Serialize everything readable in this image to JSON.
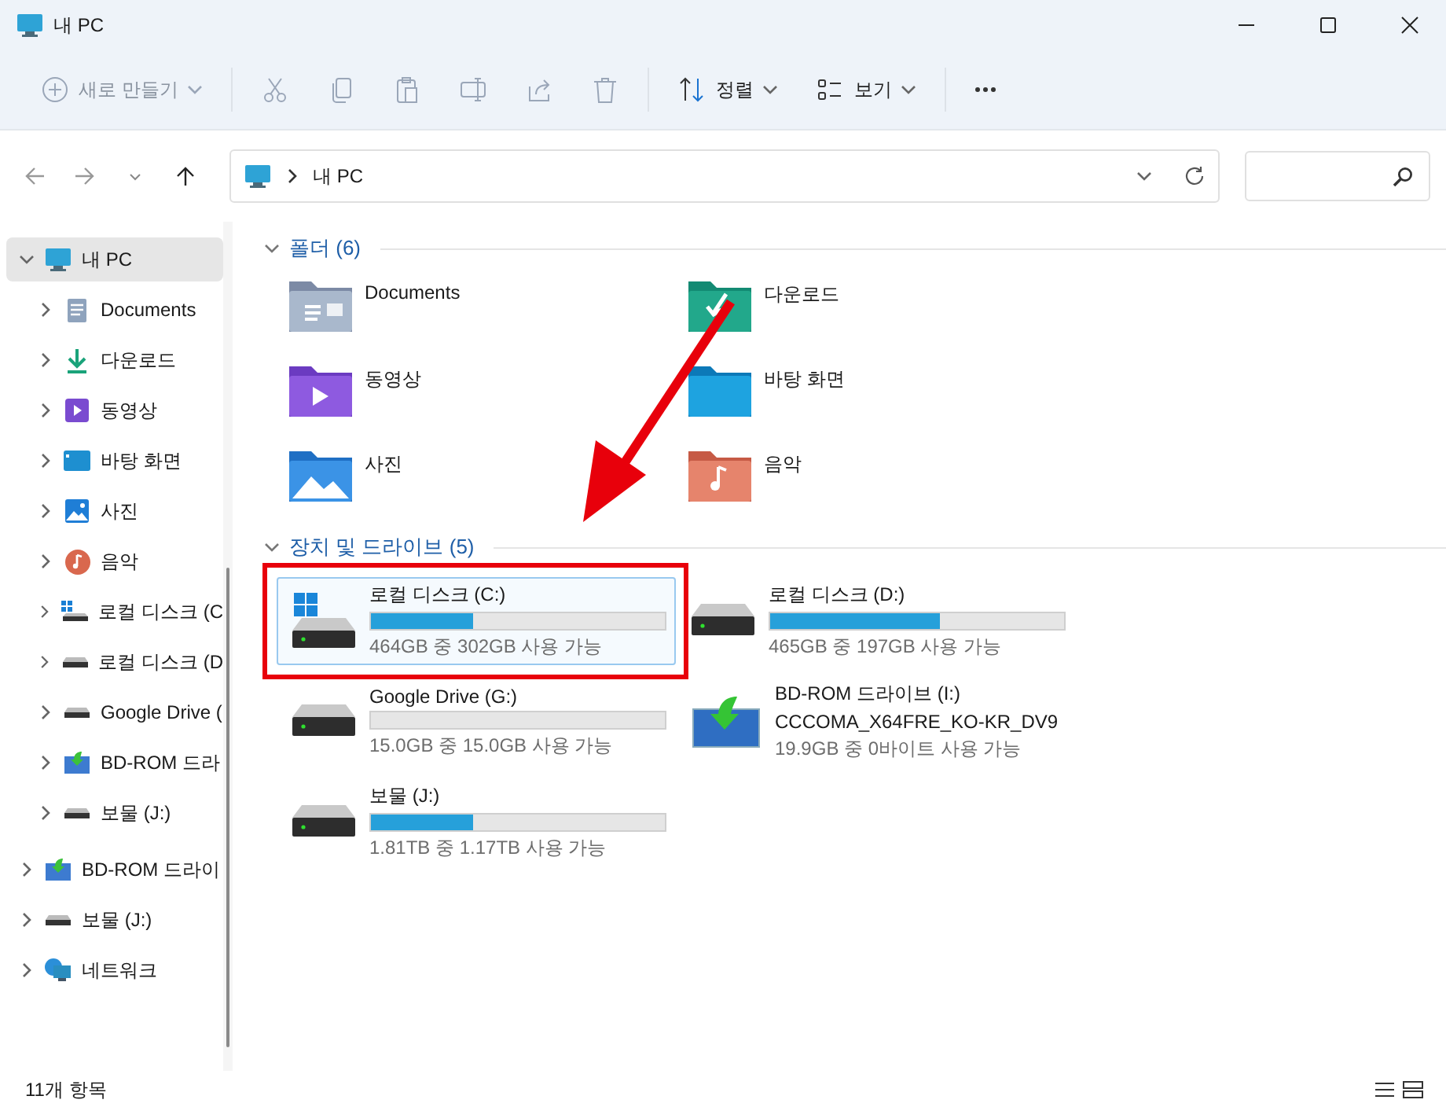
{
  "window": {
    "title": "내 PC"
  },
  "toolbar": {
    "items": [
      {
        "kind": "new",
        "label": "새로 만들기",
        "disabled": true
      },
      {
        "kind": "cut",
        "disabled": true
      },
      {
        "kind": "copy",
        "disabled": true
      },
      {
        "kind": "paste",
        "disabled": true
      },
      {
        "kind": "rename",
        "disabled": true
      },
      {
        "kind": "share",
        "disabled": true
      },
      {
        "kind": "delete",
        "disabled": true
      },
      {
        "kind": "sort",
        "label": "정렬",
        "disabled": false
      },
      {
        "kind": "view",
        "label": "보기",
        "disabled": false
      },
      {
        "kind": "more",
        "disabled": false
      }
    ]
  },
  "navigation": {
    "back_disabled": true,
    "forward_disabled": true,
    "up_disabled": false
  },
  "address": {
    "path": "내 PC"
  },
  "sidebar": {
    "items": [
      {
        "label": "내 PC",
        "kind": "pc",
        "selected": true,
        "expanded": true,
        "children": [
          {
            "label": "Documents",
            "kind": "documents",
            "selected": false,
            "expanded": false
          },
          {
            "label": "다운로드",
            "kind": "downloads",
            "selected": false,
            "expanded": false
          },
          {
            "label": "동영상",
            "kind": "videos",
            "selected": false,
            "expanded": false
          },
          {
            "label": "바탕 화면",
            "kind": "desktop",
            "selected": false,
            "expanded": false
          },
          {
            "label": "사진",
            "kind": "pictures",
            "selected": false,
            "expanded": false
          },
          {
            "label": "음악",
            "kind": "music",
            "selected": false,
            "expanded": false
          },
          {
            "label": "로컬 디스크 (C",
            "kind": "windisk",
            "selected": false,
            "expanded": false
          },
          {
            "label": "로컬 디스크 (D",
            "kind": "disk",
            "selected": false,
            "expanded": false
          },
          {
            "label": "Google Drive (",
            "kind": "disk",
            "selected": false,
            "expanded": false
          },
          {
            "label": "BD-ROM 드라",
            "kind": "bdrom",
            "selected": false,
            "expanded": false
          },
          {
            "label": "보물 (J:)",
            "kind": "disk",
            "selected": false,
            "expanded": false
          }
        ]
      },
      {
        "label": "BD-ROM 드라이",
        "kind": "bdrom",
        "selected": false,
        "expanded": false
      },
      {
        "label": "보물 (J:)",
        "kind": "disk",
        "selected": false,
        "expanded": false
      },
      {
        "label": "네트워크",
        "kind": "network",
        "selected": false,
        "expanded": false
      }
    ]
  },
  "sections": [
    {
      "title": "폴더",
      "count": "(6)",
      "expanded": true,
      "kind": "folders",
      "items": [
        {
          "label": "Documents",
          "kind": "documents"
        },
        {
          "label": "다운로드",
          "kind": "downloads"
        },
        {
          "label": "동영상",
          "kind": "videos"
        },
        {
          "label": "바탕 화면",
          "kind": "desktop"
        },
        {
          "label": "사진",
          "kind": "pictures"
        },
        {
          "label": "음악",
          "kind": "music"
        }
      ]
    },
    {
      "title": "장치 및 드라이브",
      "count": "(5)",
      "expanded": true,
      "kind": "drives",
      "items": [
        {
          "label": "로컬 디스크 (C:)",
          "kind": "windisk",
          "level": 0.35,
          "space": "464GB 중 302GB 사용 가능",
          "selected": true,
          "highlighted": true
        },
        {
          "label": "로컬 디스크 (D:)",
          "kind": "disk",
          "level": 0.58,
          "space": "465GB 중 197GB 사용 가능",
          "selected": false,
          "highlighted": false
        },
        {
          "label": "Google Drive (G:)",
          "kind": "disk",
          "level": 0,
          "space": "15.0GB 중 15.0GB 사용 가능",
          "selected": false,
          "highlighted": false
        },
        {
          "label": "BD-ROM 드라이브 (I:)",
          "kind": "bdrom",
          "volume": "CCCOMA_X64FRE_KO-KR_DV9",
          "space": "19.9GB 중 0바이트 사용 가능",
          "selected": false,
          "highlighted": false
        },
        {
          "label": "보물 (J:)",
          "kind": "disk",
          "level": 0.35,
          "space": "1.81TB 중 1.17TB 사용 가능",
          "selected": false,
          "highlighted": false
        }
      ]
    }
  ],
  "status_bar": {
    "count": "11개 항목"
  }
}
